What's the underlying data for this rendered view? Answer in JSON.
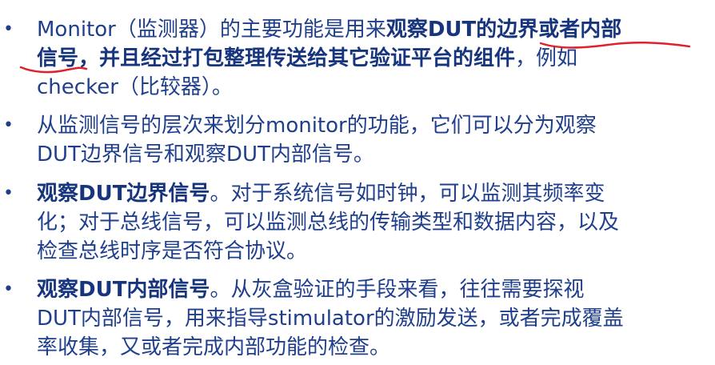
{
  "bullets": [
    {
      "marker": "•",
      "lines": [
        [
          {
            "text": "Monitor（监测器）的主要功能是用来",
            "bold": false
          },
          {
            "text": "观察DUT的边界或者内部",
            "bold": true
          }
        ],
        [
          {
            "text": "信号，并且经过打包整理传送给其它验证平台的组件",
            "bold": true
          },
          {
            "text": "，例如",
            "bold": false
          }
        ],
        [
          {
            "text": "checker（比较器）。",
            "bold": false
          }
        ]
      ]
    },
    {
      "marker": "•",
      "lines": [
        [
          {
            "text": "从监测信号的层次来划分monitor的功能，它们可以分为观察",
            "bold": false
          }
        ],
        [
          {
            "text": "DUT边界信号和观察DUT内部信号。",
            "bold": false
          }
        ]
      ]
    },
    {
      "marker": "•",
      "lines": [
        [
          {
            "text": "观察DUT边界信号",
            "bold": true
          },
          {
            "text": "。对于系统信号如时钟，可以监测其频率变",
            "bold": false
          }
        ],
        [
          {
            "text": "化；对于总线信号，可以监测总线的传输类型和数据内容，以及",
            "bold": false
          }
        ],
        [
          {
            "text": "检查总线时序是否符合协议。",
            "bold": false
          }
        ]
      ]
    },
    {
      "marker": "•",
      "lines": [
        [
          {
            "text": "观察DUT内部信号",
            "bold": true
          },
          {
            "text": "。从灰盒验证的手段来看，往往需要探视",
            "bold": false
          }
        ],
        [
          {
            "text": "DUT内部信号，用来指导stimulator的激励发送，或者完成覆盖",
            "bold": false
          }
        ],
        [
          {
            "text": "率收集，又或者完成内部功能的检查。",
            "bold": false
          }
        ]
      ]
    }
  ],
  "colors": {
    "text": "#1f3f8c",
    "bold_text": "#17357d",
    "annotation_ink": "#e0202a",
    "background": "#ffffff"
  }
}
